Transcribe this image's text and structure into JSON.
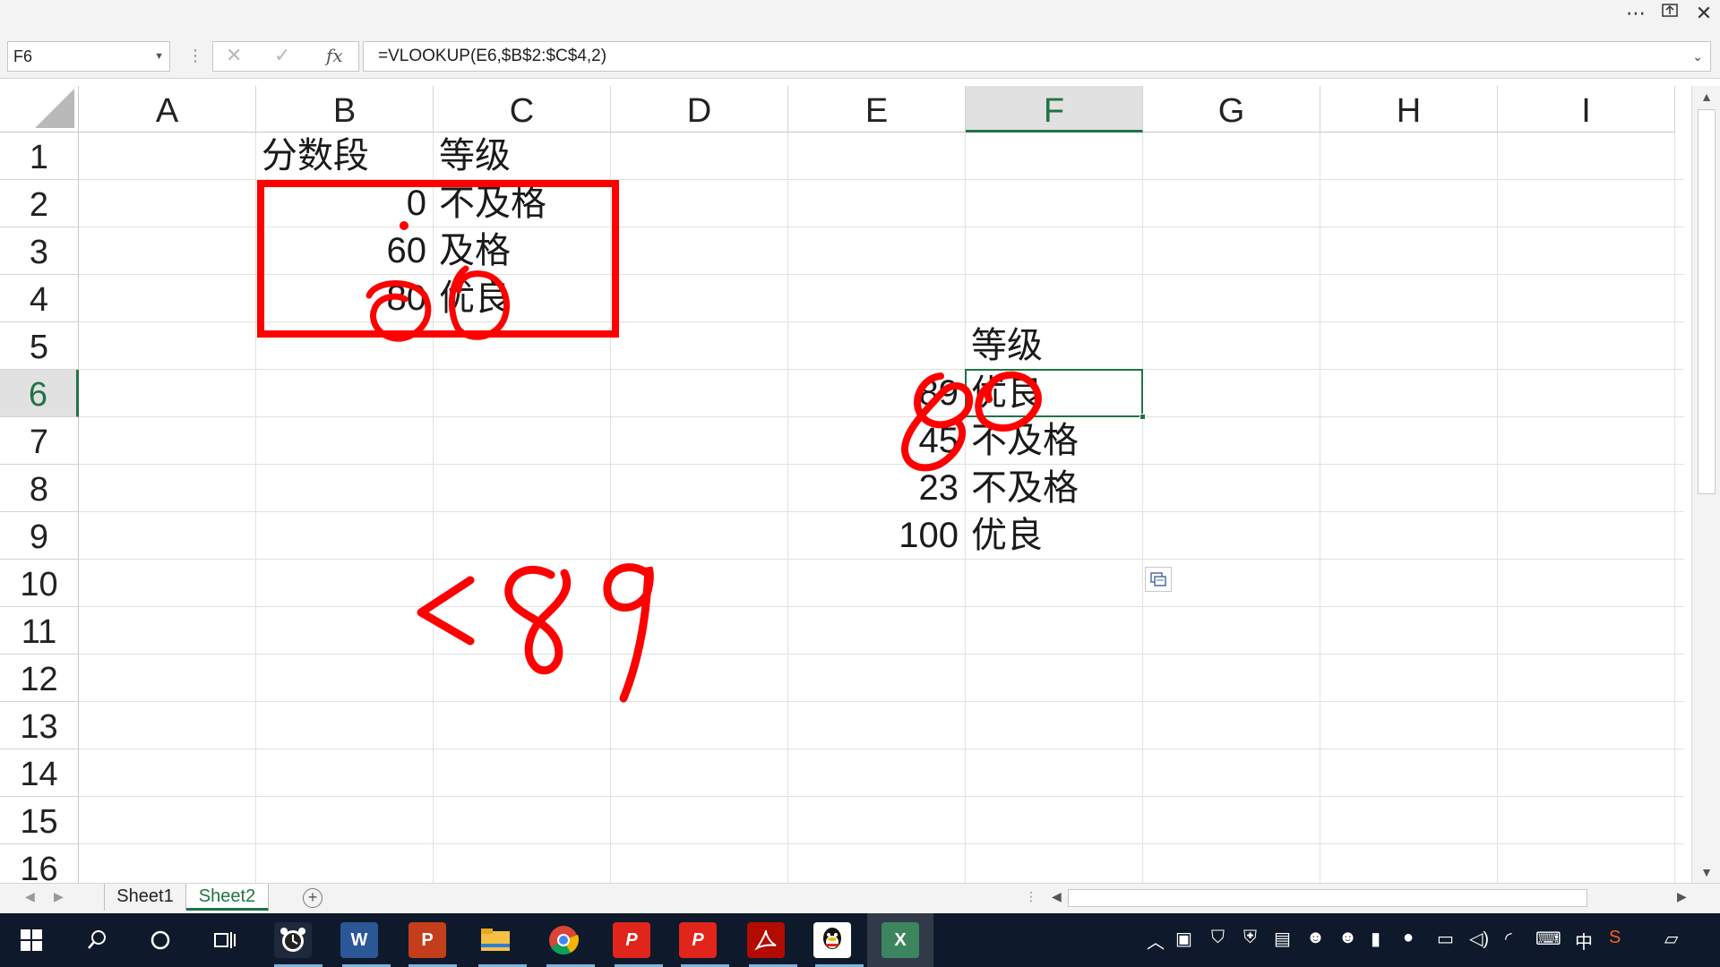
{
  "window": {
    "more_icon": "more-icon",
    "restore_icon": "restore-icon",
    "close_icon": "close-icon"
  },
  "formula_bar": {
    "name_box": "F6",
    "formula": "=VLOOKUP(E6,$B$2:$C$4,2)",
    "fx_label": "fx"
  },
  "columns": [
    "A",
    "B",
    "C",
    "D",
    "E",
    "F",
    "G",
    "H",
    "I"
  ],
  "rows": [
    "1",
    "2",
    "3",
    "4",
    "5",
    "6",
    "7",
    "8",
    "9",
    "10",
    "11",
    "12",
    "13",
    "14",
    "15",
    "16"
  ],
  "active_cell": "F6",
  "cells": {
    "B1": "分数段",
    "C1": "等级",
    "B2": "0",
    "C2": "不及格",
    "B3": "60",
    "C3": "及格",
    "B4": "80",
    "C4": "优良",
    "F5": "等级",
    "E6": "89",
    "F6": "优良",
    "E7": "45",
    "F7": "不及格",
    "E8": "23",
    "F8": "不及格",
    "E9": "100",
    "F9": "优良"
  },
  "sheets": [
    {
      "name": "Sheet1",
      "active": false
    },
    {
      "name": "Sheet2",
      "active": true
    }
  ],
  "taskbar": {
    "apps": [
      "windows-start",
      "search",
      "cortana",
      "task-view",
      "alarm",
      "word",
      "powerpoint",
      "file-explorer",
      "chrome",
      "pdf-editor",
      "pdf-editor-2",
      "acrobat",
      "qq",
      "excel"
    ],
    "input_method": "中"
  },
  "annotations": {
    "handwritten_text": "<89",
    "color": "#ff0000"
  },
  "colors": {
    "excel_green": "#217346",
    "taskbar": "#0e1a2b"
  }
}
